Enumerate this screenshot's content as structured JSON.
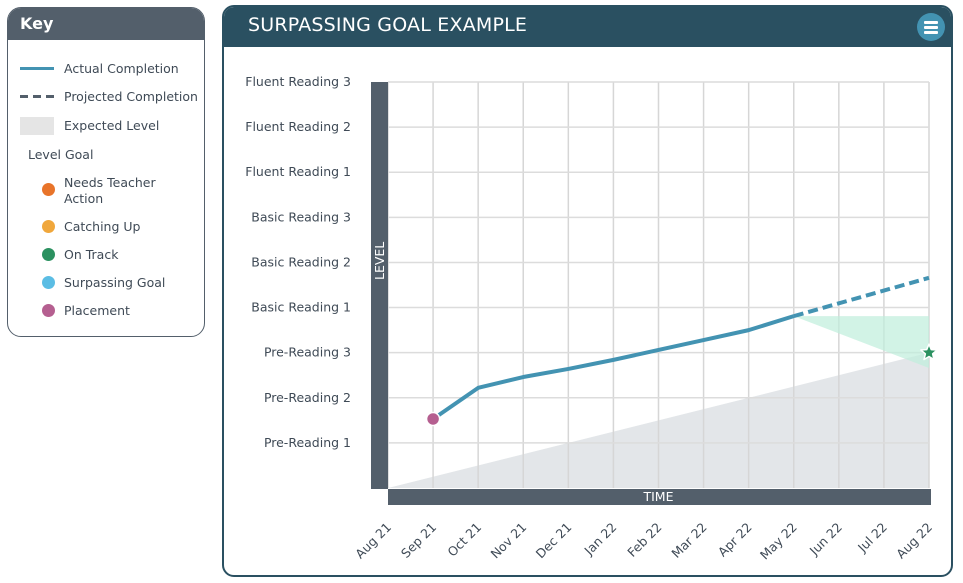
{
  "key": {
    "title": "Key",
    "items": [
      {
        "label": "Actual Completion",
        "type": "line",
        "color": "#4393b2"
      },
      {
        "label": "Projected Completion",
        "type": "dashed-line",
        "color": "#535f6b"
      },
      {
        "label": "Expected Level",
        "type": "box",
        "color": "#e5e5e5"
      }
    ],
    "level_goal_heading": "Level Goal",
    "goals": [
      {
        "label": "Needs Teacher Action",
        "color": "#e8742a"
      },
      {
        "label": "Catching Up",
        "color": "#f0a73c"
      },
      {
        "label": "On Track",
        "color": "#2b9160"
      },
      {
        "label": "Surpassing Goal",
        "color": "#5bbde4"
      },
      {
        "label": "Placement",
        "color": "#b55f90"
      }
    ]
  },
  "panel": {
    "title": "SURPASSING GOAL EXAMPLE",
    "menu_icon": "hamburger-menu-icon"
  },
  "chart_data": {
    "type": "line",
    "title": "SURPASSING GOAL EXAMPLE",
    "xlabel": "TIME",
    "ylabel": "LEVEL",
    "x": [
      "Aug 21",
      "Sep 21",
      "Oct 21",
      "Nov 21",
      "Dec 21",
      "Jan 22",
      "Feb 22",
      "Mar 22",
      "Apr 22",
      "May 22",
      "Jun 22",
      "Jul 22",
      "Aug 22"
    ],
    "y_levels": [
      "Pre-Reading 1",
      "Pre-Reading 2",
      "Pre-Reading 3",
      "Basic Reading 1",
      "Basic Reading 2",
      "Basic Reading 3",
      "Fluent Reading 1",
      "Fluent Reading 2",
      "Fluent Reading 3"
    ],
    "ylim": [
      0,
      9
    ],
    "grid": true,
    "series": [
      {
        "name": "Actual Completion",
        "style": "solid",
        "color": "#4393b2",
        "points": [
          {
            "x": "Sep 21",
            "y": 1.53
          },
          {
            "x": "Oct 21",
            "y": 2.22
          },
          {
            "x": "Nov 21",
            "y": 2.46
          },
          {
            "x": "Dec 21",
            "y": 2.64
          },
          {
            "x": "Jan 22",
            "y": 2.84
          },
          {
            "x": "Feb 22",
            "y": 3.06
          },
          {
            "x": "Mar 22",
            "y": 3.28
          },
          {
            "x": "Apr 22",
            "y": 3.5
          },
          {
            "x": "May 22",
            "y": 3.81
          }
        ]
      },
      {
        "name": "Projected Completion",
        "style": "dashed",
        "color": "#4393b2",
        "points": [
          {
            "x": "May 22",
            "y": 3.81
          },
          {
            "x": "Aug 22",
            "y": 4.66
          }
        ]
      }
    ],
    "expected_level": {
      "name": "Expected Level",
      "color": "#e3e6e9",
      "from": {
        "x": "Aug 21",
        "y": 0
      },
      "to": {
        "x": "Aug 22",
        "y": 3.0
      }
    },
    "projection_band": {
      "color": "#bfeedb",
      "apex": {
        "x": "May 22",
        "y": 3.81
      },
      "end_x": "Aug 22",
      "end_range": [
        2.66,
        3.81
      ]
    },
    "placement": {
      "x": "Sep 21",
      "y": 1.53,
      "label": "Placement",
      "color": "#b55f90"
    },
    "goal": {
      "x": "Aug 22",
      "y": 3.0,
      "status": "On Track",
      "color": "#2b9160",
      "marker": "star"
    }
  }
}
